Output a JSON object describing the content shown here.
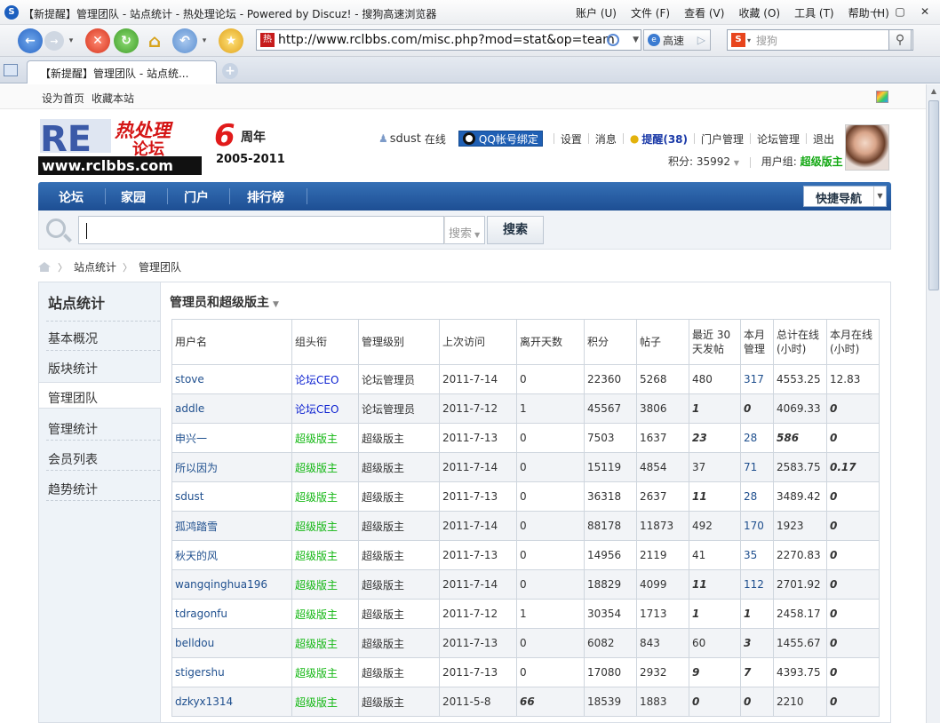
{
  "browser": {
    "title": "【新提醒】管理团队 - 站点统计 - 热处理论坛 - Powered by Discuz! - 搜狗高速浏览器",
    "menus": [
      "账户 (U)",
      "文件 (F)",
      "查看 (V)",
      "收藏 (O)",
      "工具 (T)",
      "帮助 (H)"
    ],
    "url": "http://www.rclbbs.com/misc.php?mod=stat&op=team",
    "speed_label": "高速",
    "search_placeholder": "搜狗",
    "tab_label": "【新提醒】管理团队 - 站点统..."
  },
  "topbar": {
    "set_home": "设为首页",
    "bookmark": "收藏本站"
  },
  "logo": {
    "brand": "RE",
    "cn_top": "热处理",
    "cn_bottom": "论坛",
    "big_num": "6",
    "anniv": "周年",
    "years": "2005-2011",
    "domain": "www.rclbbs.com"
  },
  "user": {
    "name": "sdust",
    "online": "在线",
    "qq_bind": "QQ帐号绑定",
    "settings": "设置",
    "messages": "消息",
    "remind": "提醒(38)",
    "portal_manage": "门户管理",
    "forum_manage": "论坛管理",
    "logout": "退出",
    "points_label": "积分: 35992",
    "group_label": "用户组:",
    "group": "超级版主"
  },
  "nav": {
    "items": [
      "论坛",
      "家园",
      "门户",
      "排行榜"
    ],
    "quick": "快捷导航"
  },
  "search": {
    "type": "搜索",
    "button": "搜索"
  },
  "breadcrumb": [
    "站点统计",
    "管理团队"
  ],
  "sidebar": {
    "title": "站点统计",
    "items": [
      "基本概况",
      "版块统计",
      "管理团队",
      "管理统计",
      "会员列表",
      "趋势统计"
    ]
  },
  "content": {
    "title": "管理员和超级版主",
    "headers": [
      "用户名",
      "组头衔",
      "管理级别",
      "上次访问",
      "离开天数",
      "积分",
      "帖子",
      "最近 30 天发帖",
      "本月管理",
      "总计在线 (小时)",
      "本月在线 (小时)"
    ],
    "rows": [
      [
        "stove",
        "论坛CEO",
        "论坛管理员",
        "2011-7-14",
        "0",
        "22360",
        "5268",
        "480",
        "317",
        "4553.25",
        "12.83"
      ],
      [
        "addle",
        "论坛CEO",
        "论坛管理员",
        "2011-7-12",
        "1",
        "45567",
        "3806",
        "1",
        "0",
        "4069.33",
        "0"
      ],
      [
        "申兴一",
        "超级版主",
        "超级版主",
        "2011-7-13",
        "0",
        "7503",
        "1637",
        "23",
        "28",
        "586",
        "0"
      ],
      [
        "所以因为",
        "超级版主",
        "超级版主",
        "2011-7-14",
        "0",
        "15119",
        "4854",
        "37",
        "71",
        "2583.75",
        "0.17"
      ],
      [
        "sdust",
        "超级版主",
        "超级版主",
        "2011-7-13",
        "0",
        "36318",
        "2637",
        "11",
        "28",
        "3489.42",
        "0"
      ],
      [
        "孤鸿踏雪",
        "超级版主",
        "超级版主",
        "2011-7-14",
        "0",
        "88178",
        "11873",
        "492",
        "170",
        "1923",
        "0"
      ],
      [
        "秋天的风",
        "超级版主",
        "超级版主",
        "2011-7-13",
        "0",
        "14956",
        "2119",
        "41",
        "35",
        "2270.83",
        "0"
      ],
      [
        "wangqinghua196",
        "超级版主",
        "超级版主",
        "2011-7-14",
        "0",
        "18829",
        "4099",
        "11",
        "112",
        "2701.92",
        "0"
      ],
      [
        "tdragonfu",
        "超级版主",
        "超级版主",
        "2011-7-12",
        "1",
        "30354",
        "1713",
        "1",
        "1",
        "2458.17",
        "0"
      ],
      [
        "belldou",
        "超级版主",
        "超级版主",
        "2011-7-13",
        "0",
        "6082",
        "843",
        "60",
        "3",
        "1455.67",
        "0"
      ],
      [
        "stigershu",
        "超级版主",
        "超级版主",
        "2011-7-13",
        "0",
        "17080",
        "2932",
        "9",
        "7",
        "4393.75",
        "0"
      ],
      [
        "dzkyx1314",
        "超级版主",
        "超级版主",
        "2011-5-8",
        "66",
        "18539",
        "1883",
        "0",
        "0",
        "2210",
        "0"
      ]
    ],
    "emphasis": [
      [
        0,
        0,
        0,
        0,
        0,
        0,
        0,
        0,
        0,
        0,
        0
      ],
      [
        0,
        0,
        0,
        0,
        0,
        0,
        0,
        1,
        1,
        0,
        1
      ],
      [
        0,
        0,
        0,
        0,
        0,
        0,
        0,
        1,
        0,
        1,
        1
      ],
      [
        0,
        0,
        0,
        0,
        0,
        0,
        0,
        0,
        0,
        0,
        1
      ],
      [
        0,
        0,
        0,
        0,
        0,
        0,
        0,
        1,
        0,
        0,
        1
      ],
      [
        0,
        0,
        0,
        0,
        0,
        0,
        0,
        0,
        0,
        0,
        1
      ],
      [
        0,
        0,
        0,
        0,
        0,
        0,
        0,
        0,
        0,
        0,
        1
      ],
      [
        0,
        0,
        0,
        0,
        0,
        0,
        0,
        1,
        0,
        0,
        1
      ],
      [
        0,
        0,
        0,
        0,
        0,
        0,
        0,
        1,
        1,
        0,
        1
      ],
      [
        0,
        0,
        0,
        0,
        0,
        0,
        0,
        0,
        1,
        0,
        1
      ],
      [
        0,
        0,
        0,
        0,
        0,
        0,
        0,
        1,
        1,
        0,
        1
      ],
      [
        0,
        0,
        0,
        0,
        1,
        0,
        0,
        1,
        1,
        0,
        1
      ]
    ]
  },
  "colors": {
    "nav_blue": "#1d4e93",
    "ceo_blue": "#0a1fd0",
    "super_green": "#13b713",
    "link_blue": "#1f4f8e"
  }
}
